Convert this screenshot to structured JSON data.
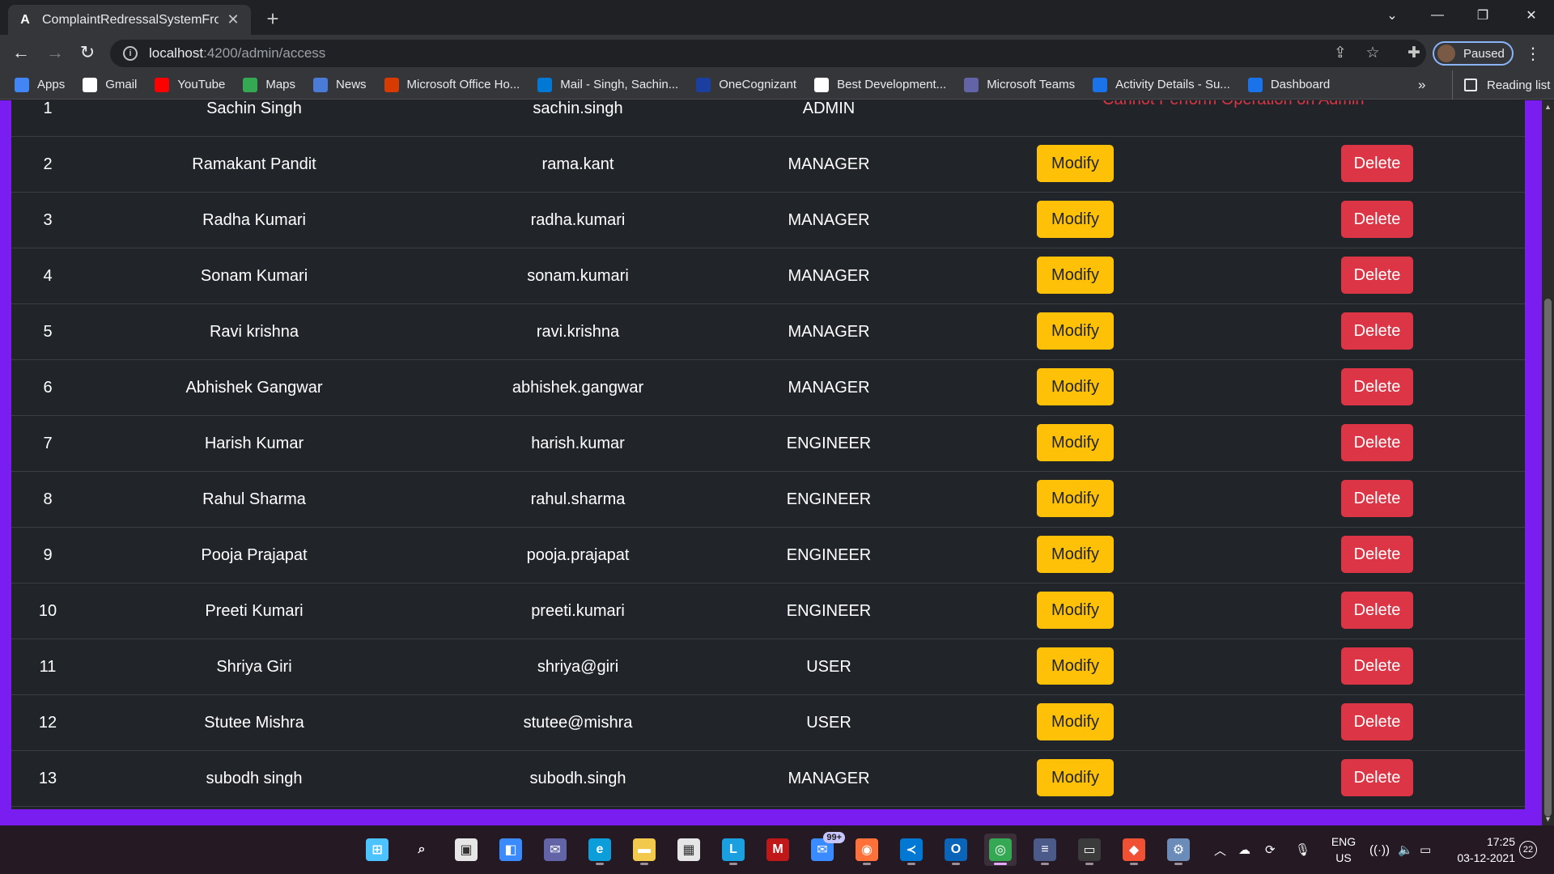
{
  "browser": {
    "tab_title": "ComplaintRedressalSystemFronte",
    "tab_favicon": "A",
    "url_host": "localhost",
    "url_rest": ":4200/admin/access",
    "profile_label": "Paused",
    "bookmarks": [
      {
        "label": "Apps",
        "icon": "apps-icon",
        "color": "#4285f4"
      },
      {
        "label": "Gmail",
        "icon": "google-icon",
        "color": "#ffffff"
      },
      {
        "label": "YouTube",
        "icon": "youtube-icon",
        "color": "#ff0000"
      },
      {
        "label": "Maps",
        "icon": "maps-icon",
        "color": "#34a853"
      },
      {
        "label": "News",
        "icon": "news-icon",
        "color": "#4a7bd6"
      },
      {
        "label": "Microsoft Office Ho...",
        "icon": "office-icon",
        "color": "#d83b01"
      },
      {
        "label": "Mail - Singh, Sachin...",
        "icon": "outlook-icon",
        "color": "#0078d4"
      },
      {
        "label": "OneCognizant",
        "icon": "onecognizant-icon",
        "color": "#1a3fa0"
      },
      {
        "label": "Best Development...",
        "icon": "info-icon",
        "color": "#ffffff"
      },
      {
        "label": "Microsoft Teams",
        "icon": "teams-icon",
        "color": "#6264a7"
      },
      {
        "label": "Activity Details - Su...",
        "icon": "c-icon",
        "color": "#1a73e8"
      },
      {
        "label": "Dashboard",
        "icon": "c-icon",
        "color": "#1a73e8"
      }
    ],
    "more_bookmarks": "»",
    "reading_list": "Reading list"
  },
  "page": {
    "error_message": "Cannot Perform Operation on Admin",
    "modify_label": "Modify",
    "delete_label": "Delete",
    "rows": [
      {
        "id": "1",
        "name": "Sachin Singh",
        "username": "sachin.singh",
        "role": "ADMIN",
        "actions": false
      },
      {
        "id": "2",
        "name": "Ramakant Pandit",
        "username": "rama.kant",
        "role": "MANAGER",
        "actions": true
      },
      {
        "id": "3",
        "name": "Radha Kumari",
        "username": "radha.kumari",
        "role": "MANAGER",
        "actions": true
      },
      {
        "id": "4",
        "name": "Sonam Kumari",
        "username": "sonam.kumari",
        "role": "MANAGER",
        "actions": true
      },
      {
        "id": "5",
        "name": "Ravi krishna",
        "username": "ravi.krishna",
        "role": "MANAGER",
        "actions": true
      },
      {
        "id": "6",
        "name": "Abhishek Gangwar",
        "username": "abhishek.gangwar",
        "role": "MANAGER",
        "actions": true
      },
      {
        "id": "7",
        "name": "Harish Kumar",
        "username": "harish.kumar",
        "role": "ENGINEER",
        "actions": true
      },
      {
        "id": "8",
        "name": "Rahul Sharma",
        "username": "rahul.sharma",
        "role": "ENGINEER",
        "actions": true
      },
      {
        "id": "9",
        "name": "Pooja Prajapat",
        "username": "pooja.prajapat",
        "role": "ENGINEER",
        "actions": true
      },
      {
        "id": "10",
        "name": "Preeti Kumari",
        "username": "preeti.kumari",
        "role": "ENGINEER",
        "actions": true
      },
      {
        "id": "11",
        "name": "Shriya Giri",
        "username": "shriya@giri",
        "role": "USER",
        "actions": true
      },
      {
        "id": "12",
        "name": "Stutee Mishra",
        "username": "stutee@mishra",
        "role": "USER",
        "actions": true
      },
      {
        "id": "13",
        "name": "subodh singh",
        "username": "subodh.singh",
        "role": "MANAGER",
        "actions": true
      }
    ]
  },
  "taskbar": {
    "apps": [
      {
        "name": "start-icon",
        "color": "#4cc2ff",
        "glyph": "⊞"
      },
      {
        "name": "search-icon",
        "color": "transparent",
        "glyph": "⌕"
      },
      {
        "name": "task-view-icon",
        "color": "#e6e6e6",
        "glyph": "▣"
      },
      {
        "name": "widgets-icon",
        "color": "#3a8bff",
        "glyph": "◧"
      },
      {
        "name": "chat-icon",
        "color": "#6264a7",
        "glyph": "✉"
      },
      {
        "name": "edge-icon",
        "color": "#0c9ddb",
        "glyph": "e"
      },
      {
        "name": "file-explorer-icon",
        "color": "#f2c94c",
        "glyph": "▬"
      },
      {
        "name": "store-icon",
        "color": "#e6e6e6",
        "glyph": "▦"
      },
      {
        "name": "l-app-icon",
        "color": "#1a9fe0",
        "glyph": "L"
      },
      {
        "name": "mcafee-icon",
        "color": "#c01818",
        "glyph": "M"
      },
      {
        "name": "mail-icon",
        "color": "#3a8bff",
        "glyph": "✉"
      },
      {
        "name": "firefox-icon",
        "color": "#ff7139",
        "glyph": "◉"
      },
      {
        "name": "vscode-icon",
        "color": "#0078d4",
        "glyph": "≺"
      },
      {
        "name": "outlook-icon",
        "color": "#0a64b8",
        "glyph": "O"
      },
      {
        "name": "chrome-icon",
        "color": "#34a853",
        "glyph": "◎"
      },
      {
        "name": "ubuntu-icon",
        "color": "#4c5a8a",
        "glyph": "≡"
      },
      {
        "name": "mysql-icon",
        "color": "#3b3b3b",
        "glyph": "▭"
      },
      {
        "name": "git-icon",
        "color": "#f05033",
        "glyph": "◆"
      },
      {
        "name": "settings-icon",
        "color": "#6b8cb8",
        "glyph": "⚙"
      }
    ],
    "mail_badge": "99+",
    "lang_line1": "ENG",
    "lang_line2": "US",
    "time": "17:25",
    "date": "03-12-2021",
    "notifications": "22"
  }
}
